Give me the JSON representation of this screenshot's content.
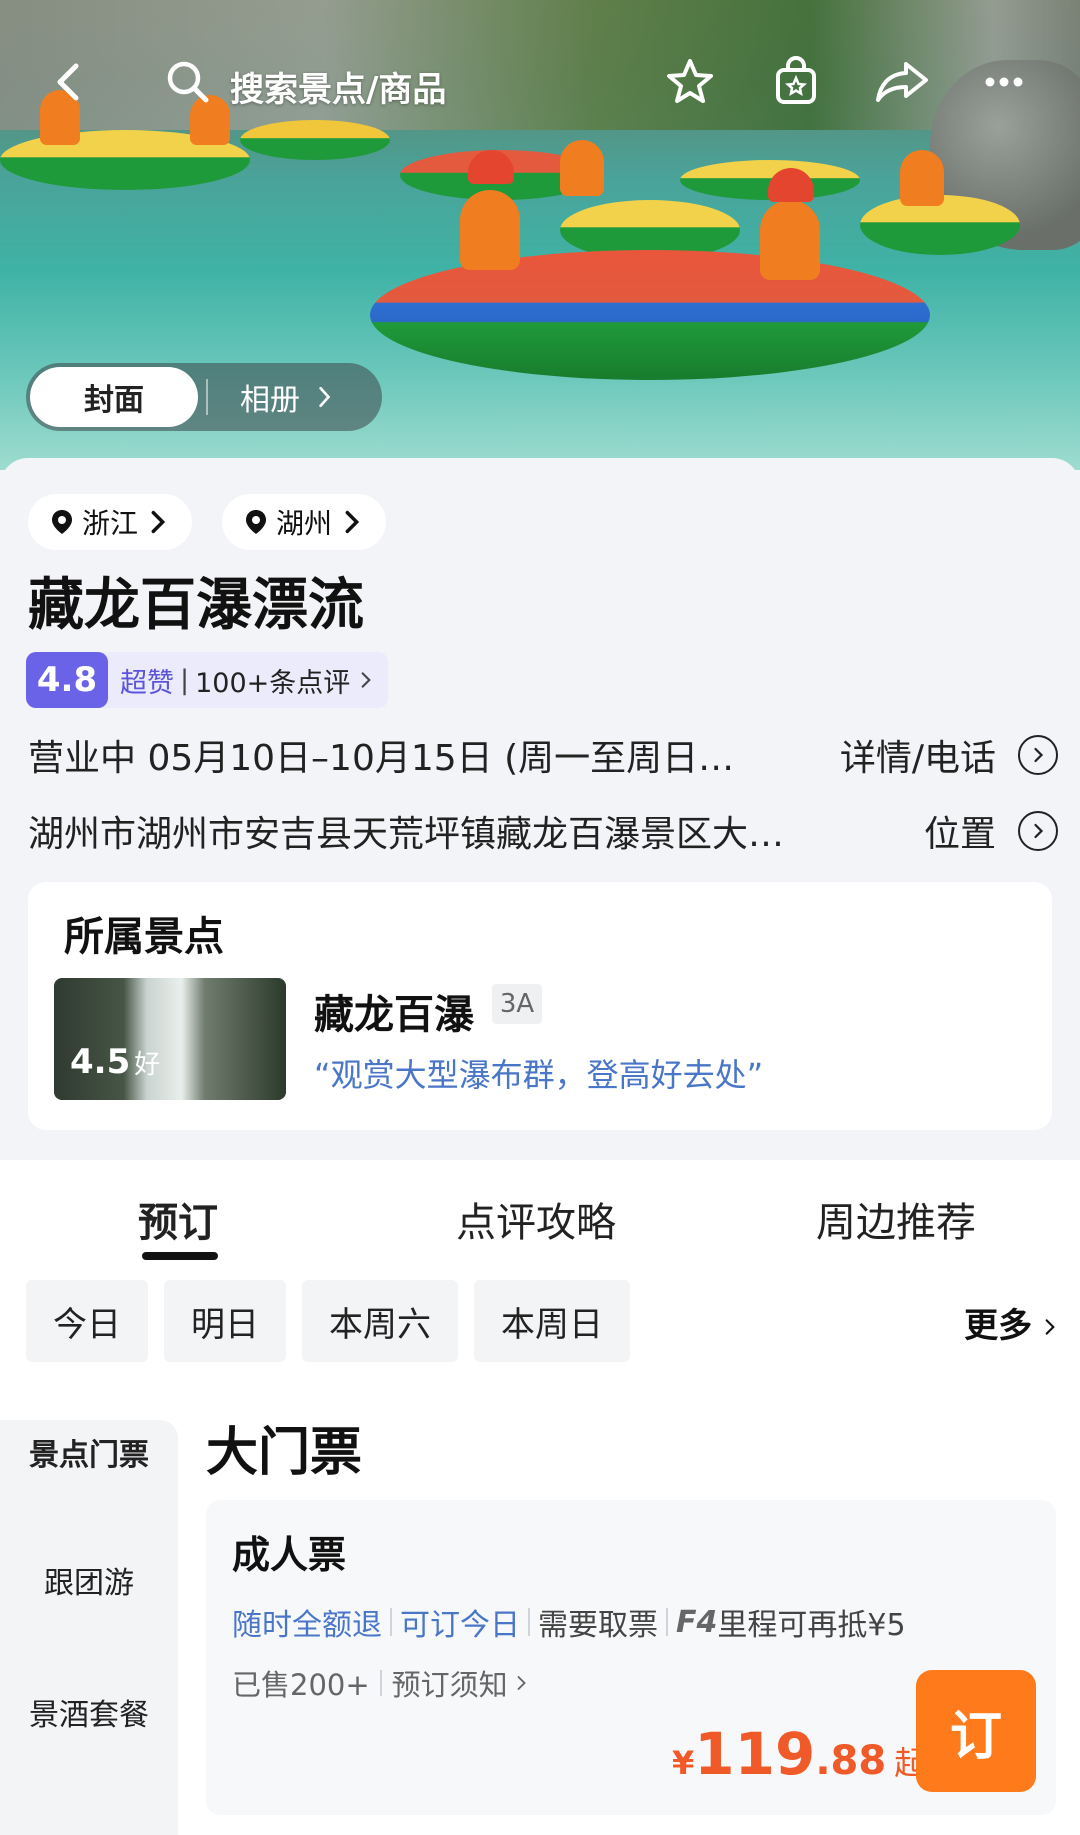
{
  "header": {
    "search_placeholder": "搜索景点/商品",
    "icons": [
      "back-icon",
      "search-icon",
      "star-icon",
      "bag-icon",
      "share-icon",
      "more-icon"
    ],
    "media_tabs": {
      "active": "封面",
      "other": "相册"
    }
  },
  "info": {
    "regions": [
      "浙江",
      "湖州"
    ],
    "title": "藏龙百瀑漂流",
    "rating": {
      "score": "4.8",
      "level": "超赞",
      "separator": "|",
      "count": "100+条点评"
    },
    "hours": {
      "text": "营业中 05月10日–10月15日 (周一至周日…",
      "action": "详情/电话"
    },
    "address": {
      "text": "湖州市湖州市安吉县天荒坪镇藏龙百瀑景区大…",
      "action": "位置"
    },
    "spot": {
      "title": "所属景点",
      "score": "4.5",
      "score_label": "好",
      "name": "藏龙百瀑",
      "grade": "3A",
      "quote": "“观赏大型瀑布群，登高好去处”"
    }
  },
  "tabs": [
    "预订",
    "点评攻略",
    "周边推荐"
  ],
  "days": [
    "今日",
    "明日",
    "本周六",
    "本周日"
  ],
  "more_label": "更多",
  "side_nav": [
    "景点门票",
    "跟团游",
    "景酒套餐"
  ],
  "section_title": "大门票",
  "ticket": {
    "name": "成人票",
    "tags_blue": [
      "随时全额退",
      "可订今日"
    ],
    "tag_gray": "需要取票",
    "tag_f4_prefix": "F4",
    "tag_f4": "里程可再抵¥5",
    "sold": "已售200+",
    "notice": "预订须知",
    "price": {
      "currency": "¥",
      "integer": "119",
      "decimal": ".88",
      "suffix": "起"
    },
    "book_label": "订"
  },
  "colors": {
    "accent_orange": "#ff7a1a",
    "price_red": "#f05a28",
    "rating_purple": "#6a63e8",
    "link_blue": "#4a76c8"
  }
}
